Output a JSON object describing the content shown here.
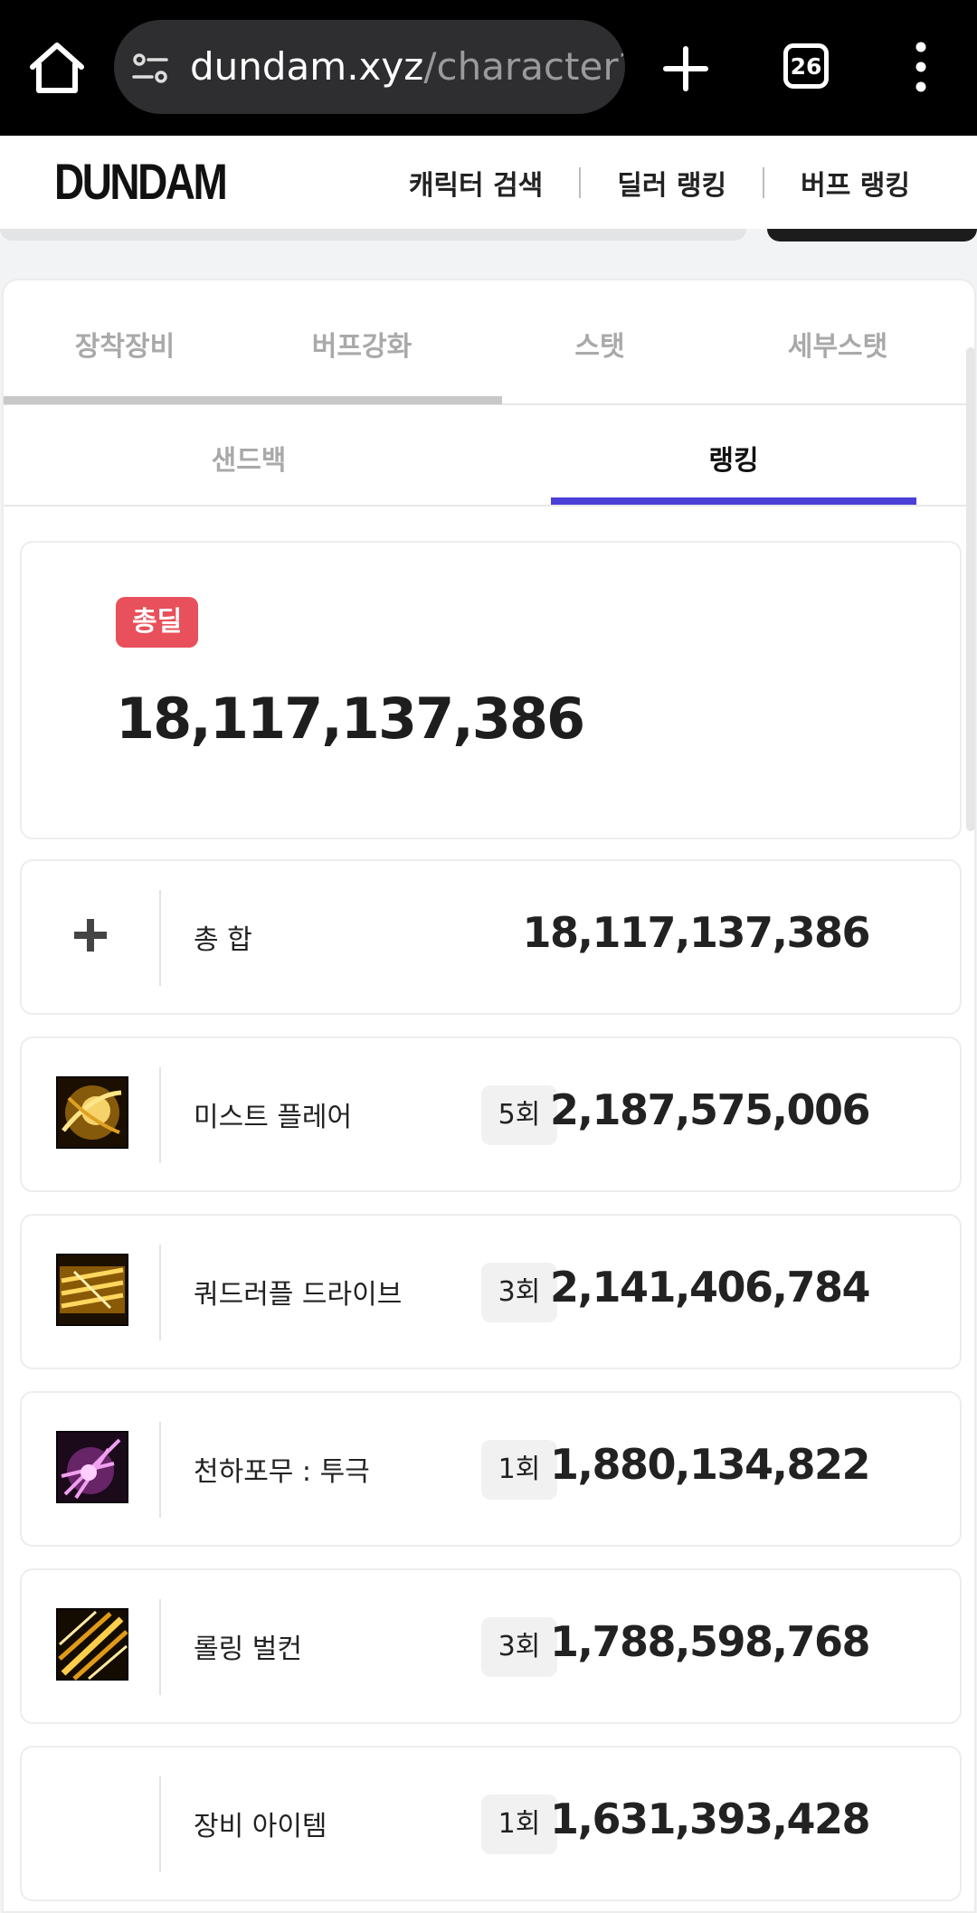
{
  "browser": {
    "url_domain": "dundam.xyz",
    "url_path": "/character?s",
    "tab_count": "26"
  },
  "site": {
    "logo": "DUNDAM",
    "nav": [
      "캐릭터 검색",
      "딜러 랭킹",
      "버프 랭킹"
    ]
  },
  "tabs_primary": [
    "장착장비",
    "버프강화",
    "스탯",
    "세부스탯"
  ],
  "tabs_secondary": [
    "샌드백",
    "랭킹"
  ],
  "total": {
    "badge": "총딜",
    "value": "18,117,137,386"
  },
  "rows": [
    {
      "icon": "plus-icon",
      "name": "총 합",
      "count": "",
      "value": "18,117,137,386"
    },
    {
      "icon": "mist-flare-skill-icon",
      "name": "미스트 플레어",
      "count": "5회",
      "value": "2,187,575,006"
    },
    {
      "icon": "quadruple-drive-skill-icon",
      "name": "쿼드러플 드라이브",
      "count": "3회",
      "value": "2,141,406,784"
    },
    {
      "icon": "cheonha-pomu-skill-icon",
      "name": "천하포무 : 투극",
      "count": "1회",
      "value": "1,880,134,822"
    },
    {
      "icon": "rolling-vulcan-skill-icon",
      "name": "롤링 벌컨",
      "count": "3회",
      "value": "1,788,598,768"
    },
    {
      "icon": "",
      "name": "장비 아이템",
      "count": "1회",
      "value": "1,631,393,428"
    }
  ],
  "colors": {
    "accent": "#4a3fd6",
    "badge": "#e8505b"
  }
}
